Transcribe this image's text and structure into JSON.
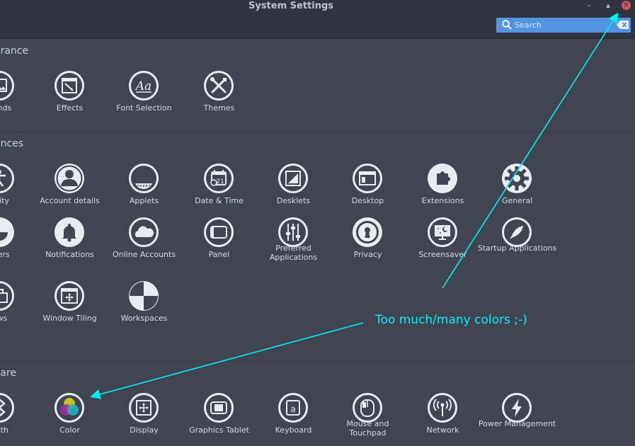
{
  "window": {
    "title": "System Settings",
    "minimize_label": "–",
    "maximize_label": "▴",
    "close_label": "✕"
  },
  "search": {
    "placeholder": "Search",
    "value": ""
  },
  "sections": [
    {
      "id": "appearance",
      "title": "arance",
      "items": [
        {
          "id": "backgrounds",
          "label": "ounds",
          "icon": "backgrounds-icon"
        },
        {
          "id": "effects",
          "label": "Effects",
          "icon": "effects-icon"
        },
        {
          "id": "font-selection",
          "label": "Font Selection",
          "icon": "font-selection-icon"
        },
        {
          "id": "themes",
          "label": "Themes",
          "icon": "themes-icon"
        }
      ]
    },
    {
      "id": "preferences",
      "title": "ences",
      "items": [
        {
          "id": "accessibility",
          "label": "bility",
          "icon": "accessibility-icon"
        },
        {
          "id": "account-details",
          "label": "Account details",
          "icon": "account-icon"
        },
        {
          "id": "applets",
          "label": "Applets",
          "icon": "applets-icon"
        },
        {
          "id": "date-time",
          "label": "Date & Time",
          "icon": "calendar-icon",
          "day": "21"
        },
        {
          "id": "desklets",
          "label": "Desklets",
          "icon": "desklets-icon"
        },
        {
          "id": "desktop",
          "label": "Desktop",
          "icon": "desktop-icon"
        },
        {
          "id": "extensions",
          "label": "Extensions",
          "icon": "puzzle-icon"
        },
        {
          "id": "general",
          "label": "General",
          "icon": "gear-icon"
        },
        {
          "id": "hot-corners",
          "label": "rners",
          "icon": "hot-corners-icon"
        },
        {
          "id": "notifications",
          "label": "Notifications",
          "icon": "bell-icon"
        },
        {
          "id": "online-accounts",
          "label": "Online Accounts",
          "icon": "cloud-icon"
        },
        {
          "id": "panel",
          "label": "Panel",
          "icon": "panel-icon"
        },
        {
          "id": "preferred-applications",
          "label": "Preferred Applications",
          "icon": "sliders-icon"
        },
        {
          "id": "privacy",
          "label": "Privacy",
          "icon": "keyhole-icon"
        },
        {
          "id": "screensaver",
          "label": "Screensaver",
          "icon": "screensaver-icon"
        },
        {
          "id": "startup-applications",
          "label": "Startup Applications",
          "icon": "rocket-icon"
        },
        {
          "id": "windows",
          "label": "ows",
          "icon": "windows-icon"
        },
        {
          "id": "window-tiling",
          "label": "Window Tiling",
          "icon": "window-tiling-icon"
        },
        {
          "id": "workspaces",
          "label": "Workspaces",
          "icon": "workspaces-icon"
        }
      ]
    },
    {
      "id": "hardware",
      "title": "vare",
      "items": [
        {
          "id": "bluetooth",
          "label": "ooth",
          "icon": "bluetooth-icon"
        },
        {
          "id": "color",
          "label": "Color",
          "icon": "color-icon"
        },
        {
          "id": "display",
          "label": "Display",
          "icon": "display-icon"
        },
        {
          "id": "graphics-tablet",
          "label": "Graphics Tablet",
          "icon": "tablet-icon"
        },
        {
          "id": "keyboard",
          "label": "Keyboard",
          "icon": "keyboard-icon",
          "glyph": "a"
        },
        {
          "id": "mouse-touchpad",
          "label": "Mouse and Touchpad",
          "icon": "mouse-icon"
        },
        {
          "id": "network",
          "label": "Network",
          "icon": "network-icon"
        },
        {
          "id": "power-management",
          "label": "Power Management",
          "icon": "power-icon"
        }
      ]
    }
  ],
  "annotation": {
    "text": "Too much/many colors ;-)",
    "color": "#00f0f5"
  },
  "colors": {
    "accent": "#5294e2",
    "close": "#cc575d",
    "background": "#404552",
    "titlebar": "#2f343f",
    "icon": "#e8ecf0"
  }
}
